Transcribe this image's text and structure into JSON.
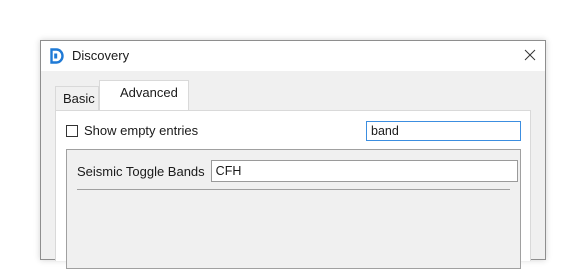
{
  "window": {
    "title": "Discovery",
    "icon": "discovery-logo-icon",
    "close_icon": "close-icon"
  },
  "tabs": [
    {
      "label": "Basic",
      "selected": false
    },
    {
      "label": "Advanced",
      "selected": true
    }
  ],
  "filter": {
    "show_empty_label": "Show empty entries",
    "show_empty_checked": false,
    "search_value": "band"
  },
  "fields": [
    {
      "label": "Seismic Toggle Bands",
      "value": "CFH"
    }
  ],
  "colors": {
    "accent": "#1f7ad6",
    "focus_border": "#3c8ee0",
    "window_bg": "#f0f0f0",
    "panel_bg": "#ffffff"
  }
}
